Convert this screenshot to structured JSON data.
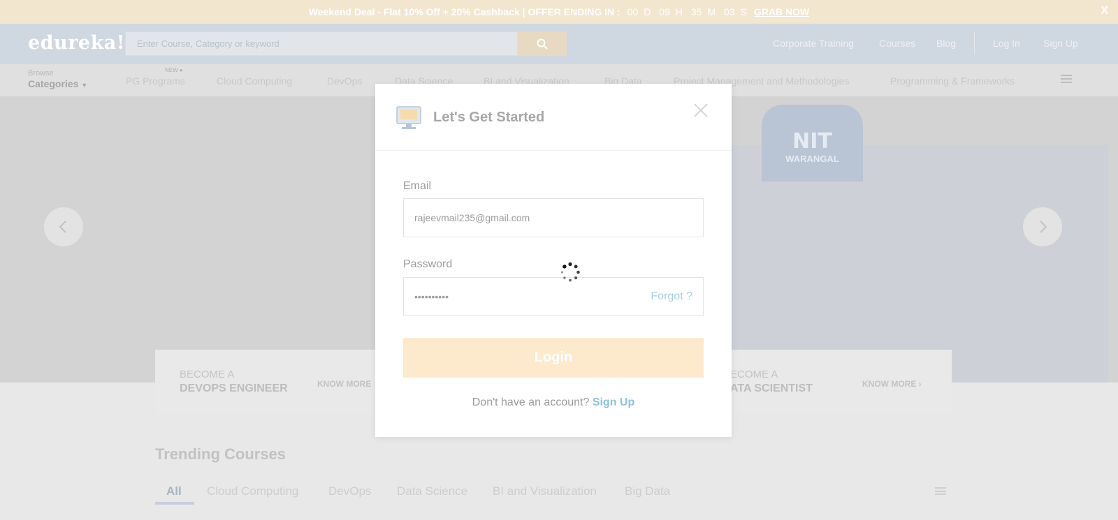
{
  "promo": {
    "deal": "Weekend Deal - Flat 10% Off + 20% Cashback | OFFER ENDING IN :",
    "countdown": [
      "00",
      "D",
      "09",
      "H",
      "35",
      "M",
      "03",
      "S"
    ],
    "cta": "GRAB NOW",
    "close": "X"
  },
  "header": {
    "logo": "edureka!",
    "search_placeholder": "Enter Course, Category or keyword",
    "nav": [
      "Corporate Training",
      "Courses",
      "Blog",
      "Log In",
      "Sign Up"
    ]
  },
  "categories_bar": {
    "browse": "Browse",
    "categories": "Categories",
    "new_tag": "NEW",
    "items": [
      "PG Programs",
      "Cloud Computing",
      "DevOps",
      "Data Science",
      "BI and Visualization",
      "Big Data",
      "Project Management and Methodologies",
      "Programming & Frameworks"
    ]
  },
  "hero": {
    "banner_text": "NIT",
    "banner_sub": "WARANGAL",
    "cards": [
      {
        "small": "BECOME A",
        "big": "DEVOPS ENGINEER",
        "cta": "KNOW MORE"
      },
      {
        "small": "BECOME A",
        "big": "DATA SCIENTIST",
        "cta": "KNOW MORE"
      }
    ],
    "card2_small": "ECOME A",
    "card2_big": "ATA SCIENTIST"
  },
  "trending": {
    "title": "Trending Courses",
    "tabs": [
      "All",
      "Cloud Computing",
      "DevOps",
      "Data Science",
      "BI and Visualization",
      "Big Data"
    ]
  },
  "modal": {
    "title": "Let's Get Started",
    "email_label": "Email",
    "email_value": "rajeevmail235@gmail.com",
    "password_label": "Password",
    "password_value": "••••••••••",
    "forgot": "Forgot ?",
    "login": "Login",
    "no_account": "Don't have an account?",
    "signup": "Sign Up"
  }
}
